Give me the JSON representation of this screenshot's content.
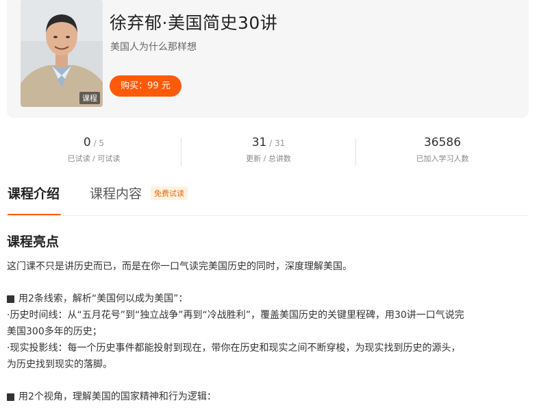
{
  "course": {
    "title": "徐弃郁·美国简史30讲",
    "subtitle": "美国人为什么那样想",
    "cover_tag": "课程",
    "buy_label": "购买：99 元"
  },
  "stats": [
    {
      "value": "0",
      "total": " / 5",
      "label": "已试读 / 可试读"
    },
    {
      "value": "31",
      "total": " / 31",
      "label": "更新 / 总讲数"
    },
    {
      "value": "36586",
      "total": "",
      "label": "已加入学习人数"
    }
  ],
  "tabs": {
    "intro": "课程介绍",
    "content": "课程内容",
    "badge": "免费试读"
  },
  "highlights": {
    "heading": "课程亮点",
    "intro": "这门课不只是讲历史而已，而是在你一口气读完美国历史的同时，深度理解美国。",
    "point1": "用2条线索，解析“美国何以成为美国”：",
    "line1a": "·历史时间线：从“五月花号”到“独立战争”再到“冷战胜利”，覆盖美国历史的关键里程碑，用30讲一口气说完",
    "line1b": "美国300多年的历史；",
    "line2a": "·现实投影线：每一个历史事件都能投射到现在，带你在历史和现实之间不断穿梭，为现实找到历史的源头，",
    "line2b": "为历史找到现实的落脚。",
    "point2": "用2个视角，理解美国的国家精神和行为逻辑："
  }
}
